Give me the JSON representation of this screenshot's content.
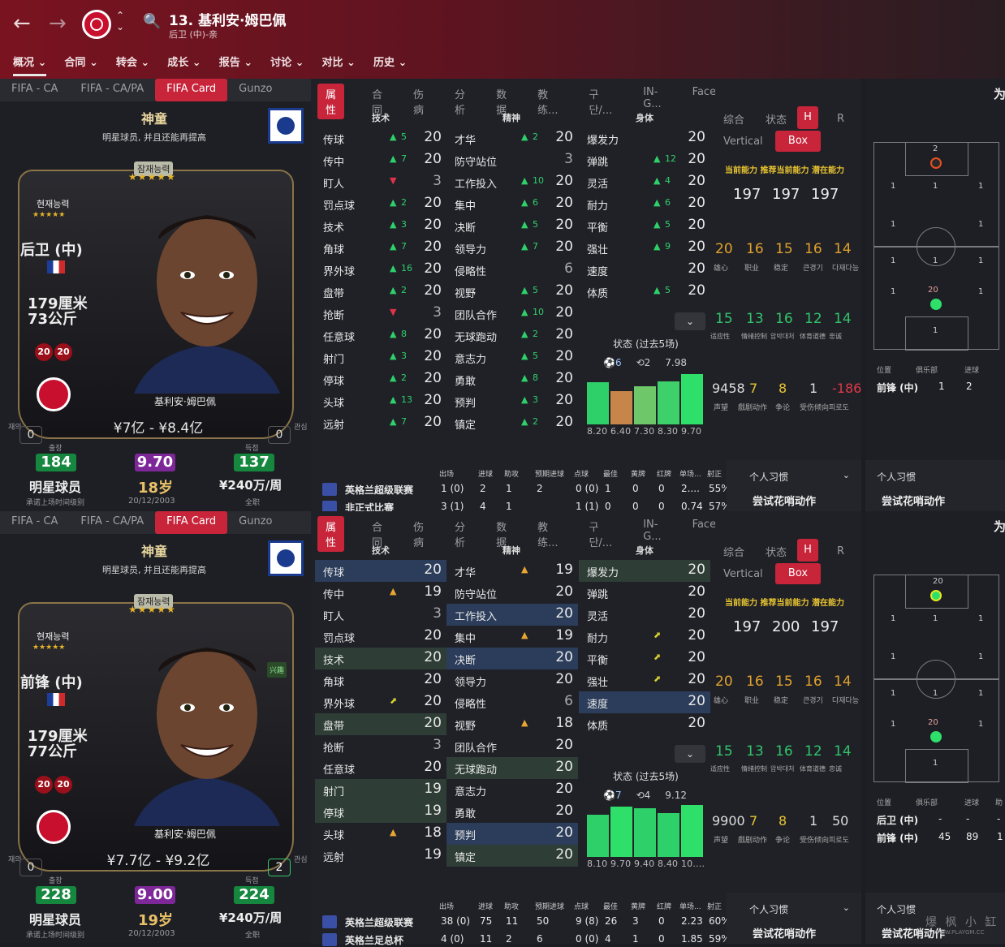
{
  "header": {
    "title": "13. 基利安·姆巴佩",
    "subtitle": "后卫 (中)-亲",
    "menu": [
      "概况",
      "合同",
      "转会",
      "成长",
      "报告",
      "讨论",
      "对比",
      "历史"
    ]
  },
  "accent": "#c8243a",
  "panels": [
    {
      "card_tabs": [
        "FIFA - CA",
        "FIFA - CA/PA",
        "FIFA Card",
        "Gunzo"
      ],
      "category": "神童",
      "category_sub": "明星球员, 并且还能再提高",
      "pot_label": "잠재능력",
      "cur_label": "현재능력",
      "position": "后卫 (中)",
      "height": "179厘米",
      "weight": "73公斤",
      "rep": [
        "20",
        "20"
      ],
      "name": "基利安·姆巴佩",
      "value": "¥7亿 - ¥8.4亿",
      "side_left": "재의",
      "side_right": "관심",
      "box_left": "0",
      "box_right": "0",
      "lbl_a": "출장",
      "lbl_c": "득점",
      "big_a": "184",
      "big_b": "9.70",
      "big_c": "137",
      "status": "明星球员",
      "age": "18岁",
      "wage": "¥240万/周",
      "tiny_a": "承诺上场时间级别",
      "tiny_b": "20/12/2003",
      "tiny_c": "全职",
      "new_tag": "",
      "attr_tabs": [
        "属性",
        "合同",
        "伤病",
        "分析",
        "数据",
        "教练...",
        "구단/...",
        "IN-G...",
        "Face..."
      ],
      "col_heads": [
        "技术",
        "精神",
        "身体"
      ],
      "tech": [
        [
          "传球",
          "▲",
          "5",
          "20"
        ],
        [
          "传中",
          "▲",
          "7",
          "20"
        ],
        [
          "盯人",
          "▼",
          "",
          "3"
        ],
        [
          "罚点球",
          "▲",
          "2",
          "20"
        ],
        [
          "技术",
          "▲",
          "3",
          "20"
        ],
        [
          "角球",
          "▲",
          "7",
          "20"
        ],
        [
          "界外球",
          "▲",
          "16",
          "20"
        ],
        [
          "盘带",
          "▲",
          "2",
          "20"
        ],
        [
          "抢断",
          "▼",
          "",
          "3"
        ],
        [
          "任意球",
          "▲",
          "8",
          "20"
        ],
        [
          "射门",
          "▲",
          "3",
          "20"
        ],
        [
          "停球",
          "▲",
          "2",
          "20"
        ],
        [
          "头球",
          "▲",
          "13",
          "20"
        ],
        [
          "远射",
          "▲",
          "7",
          "20"
        ]
      ],
      "mental": [
        [
          "才华",
          "▲",
          "2",
          "20"
        ],
        [
          "防守站位",
          "",
          "",
          "3"
        ],
        [
          "工作投入",
          "▲",
          "10",
          "20"
        ],
        [
          "集中",
          "▲",
          "6",
          "20"
        ],
        [
          "决断",
          "▲",
          "5",
          "20"
        ],
        [
          "领导力",
          "▲",
          "7",
          "20"
        ],
        [
          "侵略性",
          "",
          "",
          "6"
        ],
        [
          "视野",
          "▲",
          "5",
          "20"
        ],
        [
          "团队合作",
          "▲",
          "10",
          "20"
        ],
        [
          "无球跑动",
          "▲",
          "2",
          "20"
        ],
        [
          "意志力",
          "▲",
          "5",
          "20"
        ],
        [
          "勇敢",
          "▲",
          "8",
          "20"
        ],
        [
          "预判",
          "▲",
          "3",
          "20"
        ],
        [
          "镇定",
          "▲",
          "2",
          "20"
        ]
      ],
      "phys": [
        [
          "爆发力",
          "",
          "",
          "20"
        ],
        [
          "弹跳",
          "▲",
          "12",
          "20"
        ],
        [
          "灵活",
          "▲",
          "4",
          "20"
        ],
        [
          "耐力",
          "▲",
          "6",
          "20"
        ],
        [
          "平衡",
          "▲",
          "5",
          "20"
        ],
        [
          "强壮",
          "▲",
          "9",
          "20"
        ],
        [
          "速度",
          "",
          "",
          "20"
        ],
        [
          "体质",
          "▲",
          "5",
          "20"
        ]
      ],
      "form_label": "状态 (过去5场)",
      "form_icons": [
        "⚽6",
        "⟲2",
        "7.98"
      ],
      "form_values": [
        8.2,
        6.4,
        7.3,
        8.3,
        9.7
      ],
      "form_labels": "8.20 6.40 7.30 8.30 9.70",
      "form_colors": [
        "#2ed06a",
        "#c8854a",
        "#6ec86a",
        "#3ed06a",
        "#2ee06a"
      ],
      "r_tabs": [
        "综合",
        "状态",
        "H",
        "R"
      ],
      "vertical": "Vertical",
      "box": "Box",
      "cap_label": "当前能力 推荐当前能力 潜在能力",
      "caps": [
        "197",
        "197",
        "197"
      ],
      "pers1": [
        "20",
        "16",
        "15",
        "16",
        "14"
      ],
      "pers1_lbl": [
        "雄心",
        "职业",
        "稳定",
        "큰경기",
        "다재다능"
      ],
      "pers2": [
        "15",
        "13",
        "16",
        "12",
        "14"
      ],
      "pers2_lbl": [
        "适应性",
        "情绪控制",
        "압박대처",
        "体育道德",
        "忠诚"
      ],
      "rep_vals": [
        "9458",
        "7",
        "8",
        "1",
        "-186"
      ],
      "rep_lbl": [
        "声望",
        "戲剧动作",
        "争论",
        "受伤倾向",
        "피로도"
      ],
      "stats_head": [
        "出场",
        "进球",
        "助攻",
        "预期进球",
        "点球",
        "最佳",
        "黄牌",
        "红牌",
        "单场...",
        "射正"
      ],
      "stats_rows": [
        [
          "英格兰超级联赛",
          "1 (0)",
          "2",
          "1",
          "2",
          "0 (0)",
          "1",
          "0",
          "0",
          "2....",
          "55%"
        ],
        [
          "非正式比赛",
          "3 (1)",
          "4",
          "1",
          "",
          "1 (1)",
          "0",
          "0",
          "0",
          "0.74",
          "57%"
        ]
      ],
      "habit_hd": "个人习惯",
      "habit_val": "尝试花哨动作",
      "habit2_hd": "个人习惯",
      "habit2_val": "尝试花哨动作",
      "wei": "为",
      "pos_head": [
        "位置",
        "俱乐部",
        "进球"
      ],
      "pos_rows": [
        [
          "前锋 (中)",
          "1",
          "2"
        ]
      ],
      "pitch_top": "2",
      "pitch_low": "20",
      "pitch_nums": [
        "1",
        "1",
        "1",
        "1",
        "1",
        "1",
        "1",
        "1",
        "1",
        "1",
        "1"
      ]
    },
    {
      "card_tabs": [
        "FIFA - CA",
        "FIFA - CA/PA",
        "FIFA Card",
        "Gunzo"
      ],
      "category": "神童",
      "category_sub": "明星球员, 并且还能再提高",
      "pot_label": "잠재능력",
      "cur_label": "현재능력",
      "position": "前锋 (中)",
      "height": "179厘米",
      "weight": "77公斤",
      "rep": [
        "20",
        "20"
      ],
      "name": "基利安·姆巴佩",
      "value": "¥7.7亿 - ¥9.2亿",
      "side_left": "재의",
      "side_right": "관심",
      "box_left": "0",
      "box_right": "2",
      "lbl_a": "출장",
      "lbl_c": "득점",
      "big_a": "228",
      "big_b": "9.00",
      "big_c": "224",
      "status": "明星球员",
      "age": "19岁",
      "wage": "¥240万/周",
      "tiny_a": "承诺上场时间级别",
      "tiny_b": "20/12/2003",
      "tiny_c": "全职",
      "new_tag": "兴趣",
      "attr_tabs": [
        "属性",
        "合同",
        "伤病",
        "分析",
        "数据",
        "教练...",
        "구단/...",
        "IN-G...",
        "Face..."
      ],
      "col_heads": [
        "技术",
        "精神",
        "身体"
      ],
      "tech": [
        [
          "传球",
          "",
          "",
          "20",
          "b"
        ],
        [
          "传中",
          "▲",
          "",
          "19"
        ],
        [
          "盯人",
          "",
          "",
          "3"
        ],
        [
          "罚点球",
          "",
          "",
          "20"
        ],
        [
          "技术",
          "",
          "",
          "20",
          "g"
        ],
        [
          "角球",
          "",
          "",
          "20"
        ],
        [
          "界外球",
          "⬈",
          "",
          "20"
        ],
        [
          "盘带",
          "",
          "",
          "20",
          "g"
        ],
        [
          "抢断",
          "",
          "",
          "3"
        ],
        [
          "任意球",
          "",
          "",
          "20"
        ],
        [
          "射门",
          "",
          "",
          "19",
          "g"
        ],
        [
          "停球",
          "",
          "",
          "19",
          "g"
        ],
        [
          "头球",
          "▲",
          "",
          "18"
        ],
        [
          "远射",
          "",
          "",
          "19"
        ]
      ],
      "mental": [
        [
          "才华",
          "▲",
          "",
          "19"
        ],
        [
          "防守站位",
          "",
          "",
          "20"
        ],
        [
          "工作投入",
          "",
          "",
          "20",
          "b"
        ],
        [
          "集中",
          "▲",
          "",
          "19"
        ],
        [
          "决断",
          "",
          "",
          "20",
          "b"
        ],
        [
          "领导力",
          "",
          "",
          "20"
        ],
        [
          "侵略性",
          "",
          "",
          "6"
        ],
        [
          "视野",
          "▲",
          "",
          "18"
        ],
        [
          "团队合作",
          "",
          "",
          "20"
        ],
        [
          "无球跑动",
          "",
          "",
          "20",
          "g"
        ],
        [
          "意志力",
          "",
          "",
          "20"
        ],
        [
          "勇敢",
          "",
          "",
          "20"
        ],
        [
          "预判",
          "",
          "",
          "20",
          "b"
        ],
        [
          "镇定",
          "",
          "",
          "20",
          "g"
        ]
      ],
      "phys": [
        [
          "爆发力",
          "",
          "",
          "20",
          "g"
        ],
        [
          "弹跳",
          "",
          "",
          "20"
        ],
        [
          "灵活",
          "",
          "",
          "20"
        ],
        [
          "耐力",
          "⬈",
          "",
          "20"
        ],
        [
          "平衡",
          "⬈",
          "",
          "20"
        ],
        [
          "强壮",
          "⬈",
          "",
          "20"
        ],
        [
          "速度",
          "",
          "",
          "20",
          "b"
        ],
        [
          "体质",
          "",
          "",
          "20"
        ]
      ],
      "form_label": "状态 (过去5场)",
      "form_icons": [
        "⚽7",
        "⟲4",
        "9.12"
      ],
      "form_values": [
        8.1,
        9.7,
        9.4,
        8.4,
        10.0
      ],
      "form_labels": "8.10 9.70 9.40 8.40 10....",
      "form_colors": [
        "#2ed06a",
        "#2ee06a",
        "#2ed06a",
        "#2ed06a",
        "#2ee06a"
      ],
      "r_tabs": [
        "综合",
        "状态",
        "H",
        "R"
      ],
      "vertical": "Vertical",
      "box": "Box",
      "cap_label": "当前能力 推荐当前能力 潜在能力",
      "caps": [
        "197",
        "200",
        "197"
      ],
      "pers1": [
        "20",
        "16",
        "15",
        "16",
        "14"
      ],
      "pers1_lbl": [
        "雄心",
        "职业",
        "稳定",
        "큰경기",
        "다재다능"
      ],
      "pers2": [
        "15",
        "13",
        "16",
        "12",
        "14"
      ],
      "pers2_lbl": [
        "适应性",
        "情绪控制",
        "압박대처",
        "体育道德",
        "忠诚"
      ],
      "rep_vals": [
        "9900",
        "7",
        "8",
        "1",
        "50"
      ],
      "rep_lbl": [
        "声望",
        "戲剧动作",
        "争论",
        "受伤倾向",
        "피로도"
      ],
      "stats_head": [
        "出场",
        "进球",
        "助攻",
        "预期进球",
        "点球",
        "最佳",
        "黄牌",
        "红牌",
        "单场...",
        "射正"
      ],
      "stats_rows": [
        [
          "英格兰超级联赛",
          "38 (0)",
          "75",
          "11",
          "50",
          "9 (8)",
          "26",
          "3",
          "0",
          "2.23",
          "60%"
        ],
        [
          "英格兰足总杯",
          "4 (0)",
          "11",
          "2",
          "6",
          "0 (0)",
          "4",
          "1",
          "0",
          "1.85",
          "59%"
        ]
      ],
      "habit_hd": "个人习惯",
      "habit_val": "尝试花哨动作",
      "habit2_hd": "个人习惯",
      "habit2_val": "尝试花哨动作",
      "wei": "为",
      "pos_head": [
        "位置",
        "俱乐部",
        "进球",
        "助"
      ],
      "pos_rows": [
        [
          "后卫 (中)",
          "-",
          "-",
          "-"
        ],
        [
          "前锋 (中)",
          "45",
          "89",
          "1"
        ]
      ],
      "pitch_top": "20",
      "pitch_low": "20",
      "pitch_nums": [
        "1",
        "1",
        "1",
        "1",
        "1",
        "1",
        "1",
        "1",
        "1",
        "1",
        "1"
      ]
    }
  ],
  "watermark": "爆 枫 小 缸",
  "watermark2": "WWW.PLAYGM.CC"
}
